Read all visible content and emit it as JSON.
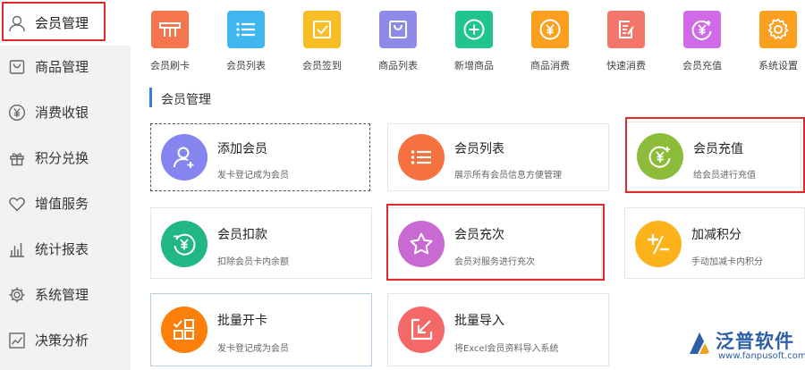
{
  "sidebar": {
    "items": [
      {
        "label": "会员管理",
        "icon": "user-icon"
      },
      {
        "label": "商品管理",
        "icon": "bag-icon"
      },
      {
        "label": "消费收银",
        "icon": "yen-circle-icon"
      },
      {
        "label": "积分兑换",
        "icon": "gift-icon"
      },
      {
        "label": "增值服务",
        "icon": "heart-icon"
      },
      {
        "label": "统计报表",
        "icon": "bar-chart-icon"
      },
      {
        "label": "系统管理",
        "icon": "gear-icon"
      },
      {
        "label": "决策分析",
        "icon": "trend-chart-icon"
      }
    ],
    "active_index": 0
  },
  "quickbar": {
    "items": [
      {
        "label": "会员刷卡",
        "icon": "card-swipe-icon",
        "color": "#f4754e"
      },
      {
        "label": "会员列表",
        "icon": "list-icon",
        "color": "#3fb6f0"
      },
      {
        "label": "会员签到",
        "icon": "checkbox-icon",
        "color": "#f7be25"
      },
      {
        "label": "商品列表",
        "icon": "shopping-bag-icon",
        "color": "#8e8be8"
      },
      {
        "label": "新增商品",
        "icon": "plus-circle-icon",
        "color": "#21c48f"
      },
      {
        "label": "商品消费",
        "icon": "yen-circle-icon",
        "color": "#fb9f1f"
      },
      {
        "label": "快速消费",
        "icon": "edit-note-icon",
        "color": "#f3766a"
      },
      {
        "label": "会员充值",
        "icon": "recharge-icon",
        "color": "#cf6be6"
      },
      {
        "label": "系统设置",
        "icon": "gear-icon",
        "color": "#fb9f1f"
      }
    ]
  },
  "section": {
    "title": "会员管理",
    "accent": "#2f80ed"
  },
  "cards": [
    {
      "title": "添加会员",
      "desc": "发卡登记成为会员",
      "icon": "add-user-icon",
      "color": "#8585f0"
    },
    {
      "title": "会员列表",
      "desc": "展示所有会员信息方便管理",
      "icon": "list-icon",
      "color": "#f5713f"
    },
    {
      "title": "会员充值",
      "desc": "给会员进行充值",
      "icon": "recharge-icon",
      "color": "#8dbb3a"
    },
    {
      "title": "会员扣款",
      "desc": "扣除会员卡内余额",
      "icon": "refund-icon",
      "color": "#21b782"
    },
    {
      "title": "会员充次",
      "desc": "会员对服务进行充次",
      "icon": "star-icon",
      "color": "#c969d2"
    },
    {
      "title": "加减积分",
      "desc": "手动加减卡内积分",
      "icon": "plus-minus-icon",
      "color": "#fbb21b"
    },
    {
      "title": "批量开卡",
      "desc": "发卡登记成为会员",
      "icon": "grid-check-icon",
      "color": "#fb7f08"
    },
    {
      "title": "批量导入",
      "desc": "将Excel会员资料导入系统",
      "icon": "import-icon",
      "color": "#f46868"
    }
  ],
  "watermark": {
    "text": "泛普软件",
    "url": "www.fanpusoft.com",
    "color": "#2d5fa8"
  }
}
